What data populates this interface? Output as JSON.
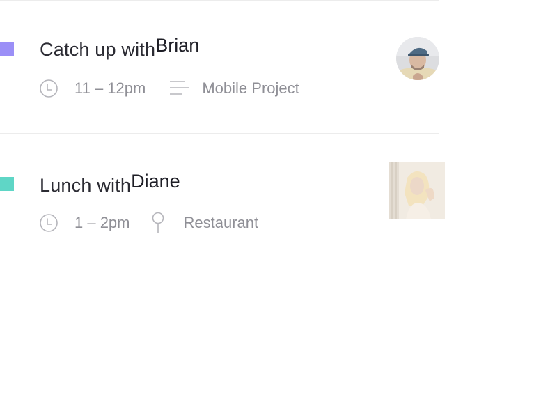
{
  "events": [
    {
      "title_prefix": "Catch up with",
      "person": "Brian",
      "time": "11 – 12pm",
      "location": "Mobile Project",
      "location_icon": "note-lines-icon",
      "color": "#9b8ff7"
    },
    {
      "title_prefix": "Lunch with",
      "person": "Diane",
      "time": "1 – 2pm",
      "location": "Restaurant",
      "location_icon": "map-pin-icon",
      "color": "#5fd6c6"
    }
  ]
}
